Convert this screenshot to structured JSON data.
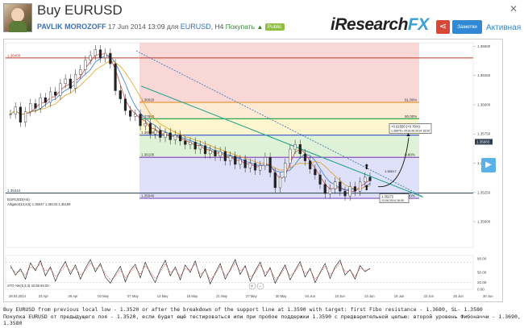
{
  "header": {
    "title": "Buy EURUSD",
    "author": "PAVLIK MOROZOFF",
    "datetime": "17 Jun 2014 13:09",
    "for_label": "для",
    "symbol": "EURUSD",
    "timeframe": ", H4",
    "direction": "Покупать",
    "visibility": "Public"
  },
  "brand": {
    "i": "i",
    "research": "Research",
    "fx": "FX"
  },
  "actions": {
    "follow_label": "Заметки",
    "status_label": "Активная",
    "share_icon": "share-icon"
  },
  "chart_data": {
    "type": "line",
    "symbol_label": "EURUSD(H4)",
    "price_axis": {
      "ylim": [
        1.3478,
        1.3653
      ],
      "ticks": [
        "1.36500",
        "1.36250",
        "1.36000",
        "1.35750",
        "1.35500",
        "1.35250",
        "1.35000"
      ]
    },
    "date_axis": [
      "28.04.2014",
      "23 Apr",
      "29 Apr",
      "02 May",
      "07 May",
      "13 May",
      "16 May",
      "21 May",
      "27 May",
      "30 May",
      "04 Jun",
      "10 Jun",
      "13 Jun",
      "18 Jun",
      "23 Jun",
      "25 Jun",
      "30 Jun"
    ],
    "horizontal_levels": [
      {
        "value": 1.364,
        "label": "1.36400",
        "color": "#c0392b"
      },
      {
        "value": 1.35244,
        "label": "1.35244",
        "color": "#2c3e50"
      }
    ],
    "fibonacci": {
      "levels": [
        {
          "label": "1.36020",
          "pct": "61.80%",
          "value": 1.3602,
          "line": "#e69a3a"
        },
        {
          "label": "1.37880",
          "pct": "50.00%",
          "value": 1.3588,
          "line": "#2ea84a"
        },
        {
          "label": "1.36909",
          "pct": "",
          "value": 1.3574,
          "line": "#3050d0"
        },
        {
          "label": "1.36105",
          "pct": "0.80%",
          "value": 1.3555,
          "line": "#8b4fc0"
        },
        {
          "label": "1.35040",
          "pct": "0.00%",
          "value": 1.352,
          "line": "#8b4fc0"
        }
      ],
      "zone_colors": [
        "#f9d0d0",
        "#fce6cc",
        "#fbf3c4",
        "#d8f0d0",
        "#d8dcf8",
        "#e8dcf4"
      ]
    },
    "price_series": [
      1.3592,
      1.3598,
      1.3585,
      1.3594,
      1.3601,
      1.3597,
      1.3606,
      1.3602,
      1.3611,
      1.3608,
      1.3618,
      1.3622,
      1.3614,
      1.3626,
      1.363,
      1.3638,
      1.3642,
      1.3647,
      1.364,
      1.3644,
      1.3635,
      1.3612,
      1.3605,
      1.3595,
      1.359,
      1.3592,
      1.3582,
      1.3584,
      1.3575,
      1.3578,
      1.3572,
      1.3576,
      1.357,
      1.3574,
      1.3569,
      1.3566,
      1.3568,
      1.3562,
      1.3565,
      1.3558,
      1.3561,
      1.3556,
      1.356,
      1.3552,
      1.3556,
      1.3549,
      1.3553,
      1.3546,
      1.355,
      1.3544,
      1.3548,
      1.3555,
      1.3542,
      1.3529,
      1.3538,
      1.355,
      1.3562,
      1.3566,
      1.3558,
      1.3552,
      1.3545,
      1.354,
      1.3532,
      1.3524,
      1.3528,
      1.3534,
      1.3526,
      1.3522,
      1.353,
      1.3526,
      1.3534,
      1.3538,
      1.3535
    ],
    "price_marker": "1.35683",
    "target_box": {
      "line1": "+0.01550 (+0.78%)",
      "line2": "1.36875 • 2019.06.2014 15:00"
    },
    "entry_box": {
      "line1": "1.35272",
      "line2": "13.06.2014 16:00"
    },
    "mid_box": {
      "line1": "1.35517"
    },
    "indicators": {
      "alligator": "Alligator(13,8,5) 1.35047 1.35132 1.35189"
    },
    "stochastic": {
      "label": "STO %K(5,3,3) 42.88 80.00",
      "ticks": [
        "90.00",
        "50.00",
        "20.00",
        "0.00"
      ],
      "ylim": [
        0,
        100
      ],
      "k_series": [
        70,
        42,
        60,
        30,
        78,
        55,
        85,
        40,
        66,
        24,
        58,
        82,
        44,
        72,
        30,
        62,
        88,
        52,
        76,
        36,
        18,
        44,
        68,
        22,
        56,
        74,
        34,
        80,
        46,
        20,
        58,
        86,
        40,
        66,
        28,
        72,
        50,
        84,
        34,
        60,
        16,
        48,
        76,
        30,
        58,
        88,
        44,
        70,
        24,
        54,
        80,
        38,
        64,
        18,
        46,
        72,
        28,
        56,
        82,
        36,
        62,
        20,
        50,
        76,
        32,
        66,
        86,
        42,
        58,
        30,
        70,
        52,
        62
      ],
      "d_series": [
        64,
        50,
        54,
        42,
        66,
        60,
        76,
        54,
        60,
        38,
        50,
        72,
        54,
        64,
        42,
        56,
        78,
        60,
        70,
        46,
        28,
        38,
        58,
        34,
        50,
        66,
        44,
        70,
        52,
        32,
        50,
        76,
        50,
        60,
        38,
        62,
        56,
        76,
        44,
        56,
        28,
        44,
        68,
        40,
        54,
        78,
        54,
        66,
        36,
        48,
        72,
        48,
        60,
        30,
        42,
        64,
        40,
        52,
        74,
        46,
        58,
        30,
        46,
        68,
        42,
        60,
        78,
        52,
        56,
        38,
        62,
        56,
        60
      ]
    }
  },
  "caption": {
    "line1": "Buy EURUSD from previous local low - 1.3520 or after the breakdown of the support line at 1.3590 with target: first Fibo resistance - 1.3680, SL- 1.3580",
    "line2": "Покупка EURUSD от предыдущего лоя - 1.3520, если будет ещё тестироваться или при пробое поддержки 1.3590 с предварительной целью: второй  уровень Фибоначчи - 1.3690, Стоп -",
    "line3": "1.3580"
  }
}
